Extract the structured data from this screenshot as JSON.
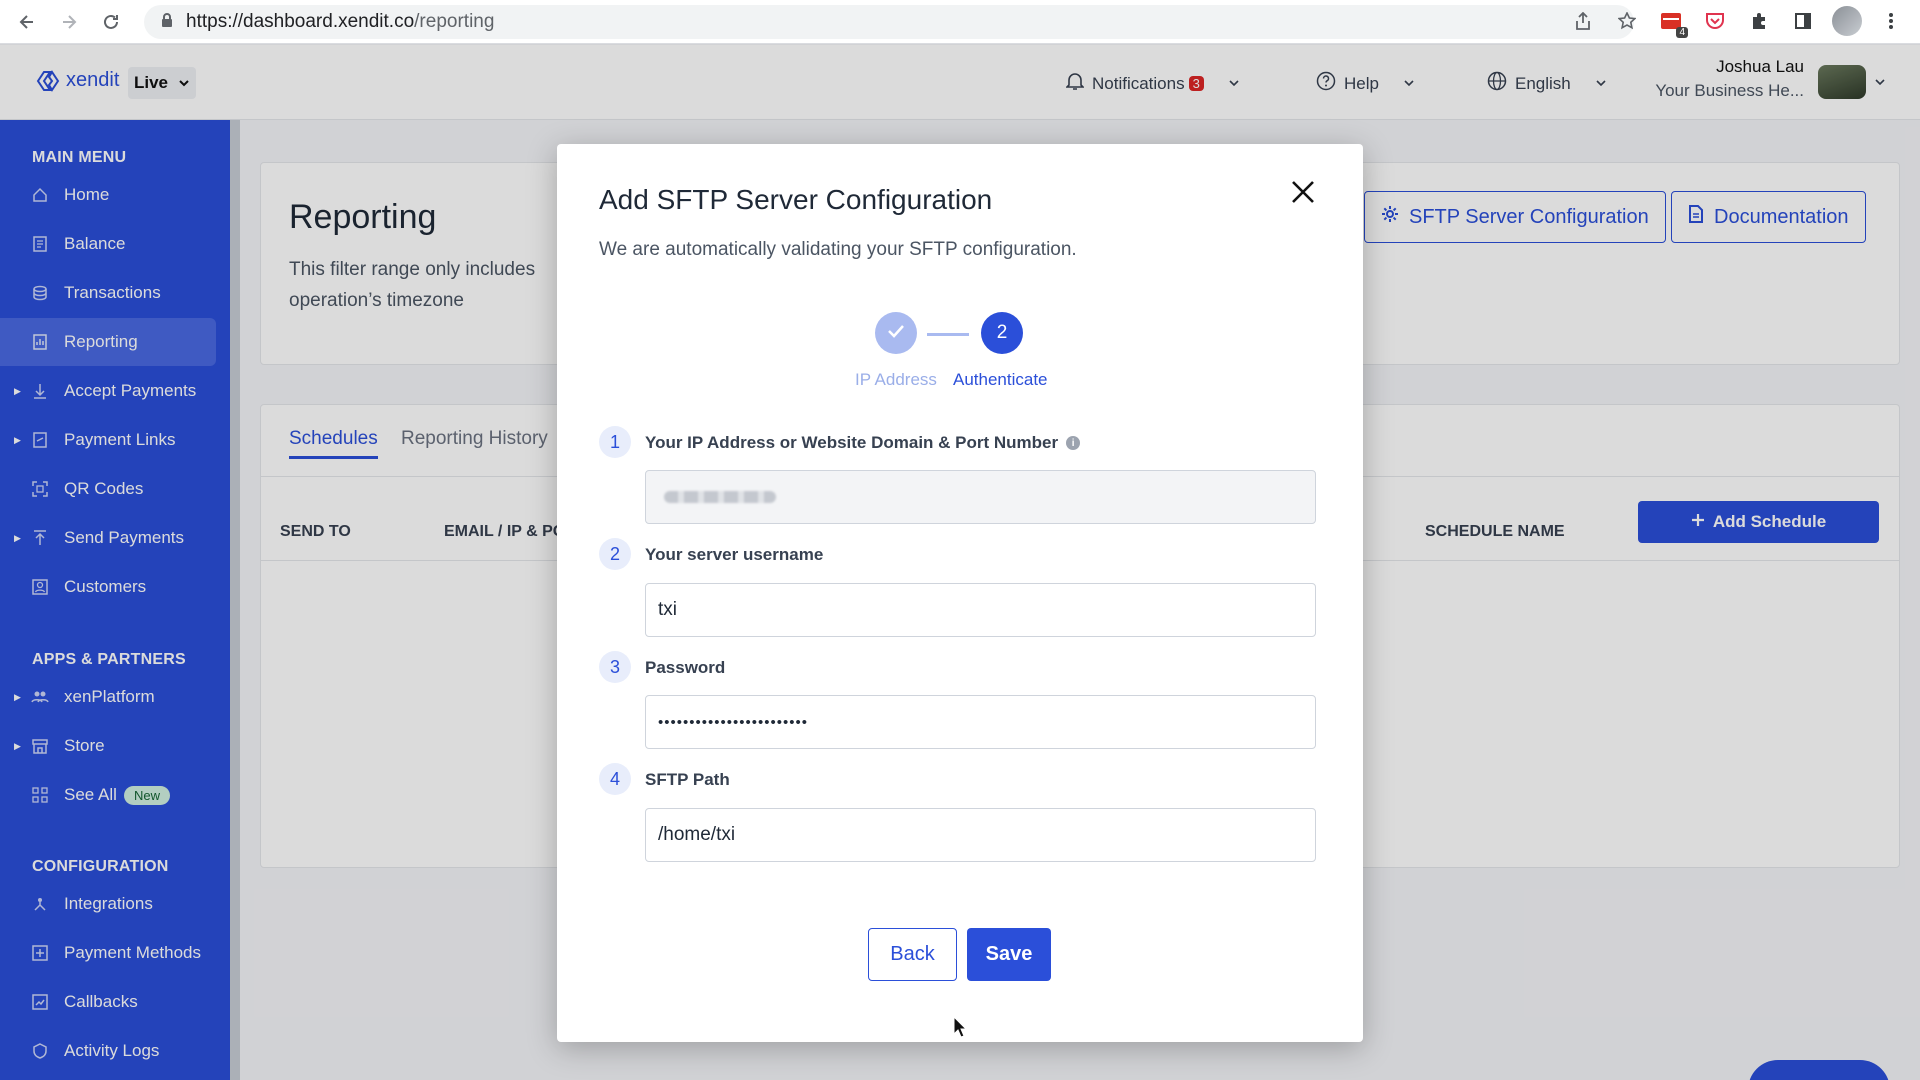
{
  "browser": {
    "url_host": "https://dashboard.xendit.co",
    "url_path": "/reporting",
    "extension_badge": "4"
  },
  "header": {
    "logo_text": "xendit",
    "environment": "Live",
    "notifications_label": "Notifications",
    "notifications_count": "3",
    "help_label": "Help",
    "language_label": "English",
    "user_name": "Joshua Lau",
    "user_business": "Your Business He..."
  },
  "sidebar": {
    "main_menu_title": "MAIN MENU",
    "main_items": [
      {
        "label": "Home",
        "icon": "home-icon"
      },
      {
        "label": "Balance",
        "icon": "balance-icon"
      },
      {
        "label": "Transactions",
        "icon": "transactions-icon"
      },
      {
        "label": "Reporting",
        "icon": "reporting-icon",
        "active": true
      },
      {
        "label": "Accept Payments",
        "icon": "accept-payments-icon",
        "expandable": true
      },
      {
        "label": "Payment Links",
        "icon": "payment-links-icon",
        "expandable": true
      },
      {
        "label": "QR Codes",
        "icon": "qr-code-icon"
      },
      {
        "label": "Send Payments",
        "icon": "send-payments-icon",
        "expandable": true
      },
      {
        "label": "Customers",
        "icon": "customers-icon"
      }
    ],
    "apps_title": "APPS & PARTNERS",
    "apps_items": [
      {
        "label": "xenPlatform",
        "icon": "platform-icon",
        "expandable": true
      },
      {
        "label": "Store",
        "icon": "store-icon",
        "expandable": true
      },
      {
        "label": "See All",
        "icon": "grid-icon",
        "badge": "New"
      }
    ],
    "config_title": "CONFIGURATION",
    "config_items": [
      {
        "label": "Integrations",
        "icon": "integrations-icon"
      },
      {
        "label": "Payment Methods",
        "icon": "payment-methods-icon"
      },
      {
        "label": "Callbacks",
        "icon": "callbacks-icon"
      },
      {
        "label": "Activity Logs",
        "icon": "activity-logs-icon"
      }
    ]
  },
  "page": {
    "title": "Reporting",
    "description": "This filter range only includes operation’s timezone",
    "sftp_button": "SFTP Server Configuration",
    "docs_button": "Documentation",
    "tabs": [
      "Schedules",
      "Reporting History"
    ],
    "columns": [
      "SEND TO",
      "EMAIL / IP & PO",
      "SCHEDULE NAME"
    ],
    "add_schedule_button": "Add Schedule"
  },
  "modal": {
    "title": "Add SFTP Server Configuration",
    "subtitle": "We are automatically validating your SFTP configuration.",
    "steps": [
      {
        "label": "IP Address",
        "state": "done"
      },
      {
        "number": "2",
        "label": "Authenticate",
        "state": "current"
      }
    ],
    "fields": [
      {
        "number": "1",
        "label": "Your IP Address or Website Domain & Port Number",
        "value": "",
        "disabled": true
      },
      {
        "number": "2",
        "label": "Your server username",
        "value": "txi"
      },
      {
        "number": "3",
        "label": "Password",
        "value": "••••••••••••••••••••••••"
      },
      {
        "number": "4",
        "label": "SFTP Path",
        "value": "/home/txi"
      }
    ],
    "back_button": "Back",
    "save_button": "Save"
  },
  "colors": {
    "brand": "#2b4fd9",
    "sidebar": "#2b4fd9",
    "badge_red": "#dc2626"
  }
}
